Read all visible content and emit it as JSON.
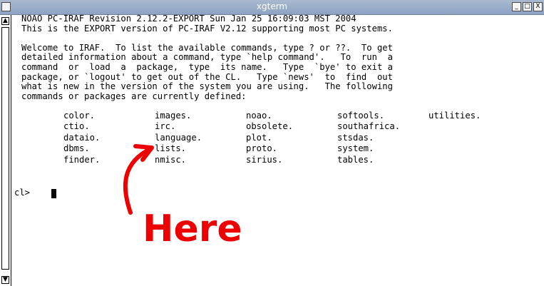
{
  "window": {
    "title": "xgterm",
    "minimize_glyph": "_",
    "maximize_glyph": "□",
    "close_glyph": "X"
  },
  "scrollbar": {
    "up_glyph": "▲",
    "down_glyph": "▼"
  },
  "terminal": {
    "header_lines": [
      "NOAO PC-IRAF Revision 2.12.2-EXPORT Sun Jan 25 16:09:03 MST 2004",
      "This is the EXPORT version of PC-IRAF V2.12 supporting most PC systems."
    ],
    "welcome_lines": [
      "Welcome to IRAF.  To list the available commands, type ? or ??.  To get",
      "detailed information about a command, type `help command'.   To  run  a",
      "command  or  load  a  package,  type  its name.   Type  `bye' to exit a",
      "package, or `logout' to get out of the CL.   Type `news'  to  find  out",
      "what is new in the version of the system you are using.   The following",
      "commands or packages are currently defined:"
    ],
    "packages": [
      [
        "color.",
        "images.",
        "noao.",
        "softools.",
        "utilities."
      ],
      [
        "ctio.",
        "irc.",
        "obsolete.",
        "southafrica."
      ],
      [
        "dataio.",
        "language.",
        "plot.",
        "stsdas."
      ],
      [
        "dbms.",
        "lists.",
        "proto.",
        "system."
      ],
      [
        "finder.",
        "nmisc.",
        "sirius.",
        "tables."
      ]
    ],
    "prompt": "cl>"
  },
  "annotation": {
    "text": "Here",
    "color": "#ee0000"
  }
}
